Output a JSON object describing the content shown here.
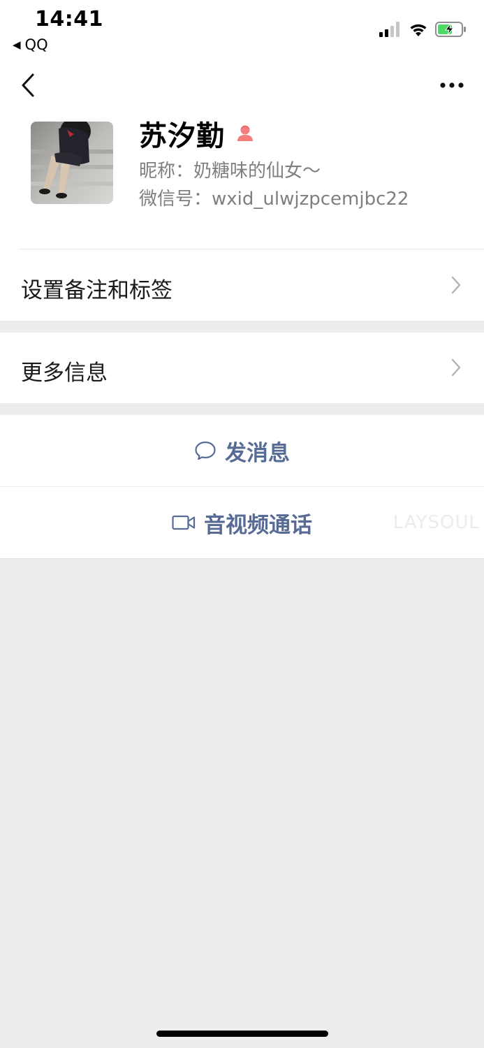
{
  "status_bar": {
    "time": "14:41",
    "back_app": "QQ",
    "back_icon": "back-to-app-triangle-icon",
    "battery_color": "#4cd964"
  },
  "nav": {
    "back_icon": "chevron-left-icon",
    "more_icon": "more-dots-icon"
  },
  "profile": {
    "name": "苏汐勤",
    "gender_icon": "female-icon",
    "gender_color": "#f37e7d",
    "nickname": "昵称：奶糖味的仙女～",
    "wxid": "微信号：wxid_ulwjzpcemjbc22"
  },
  "rows": {
    "remark_label": "设置备注和标签",
    "more_info_label": "更多信息"
  },
  "actions": {
    "send_message": "发消息",
    "send_icon": "chat-bubble-icon",
    "video_call": "音视频通话",
    "video_icon": "video-camera-icon"
  },
  "watermark": "LAYSOUL",
  "colors": {
    "link_blue": "#576b95",
    "background_gray": "#ededed"
  }
}
